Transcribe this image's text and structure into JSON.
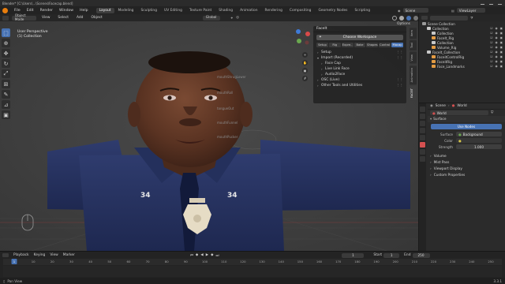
{
  "window": {
    "title": "Blender* [C:\\Users\\...\\Scenes\\Facecap.blend]"
  },
  "menubar": {
    "menus": [
      "File",
      "Edit",
      "Render",
      "Window",
      "Help"
    ],
    "workspaces": [
      "Layout",
      "Modeling",
      "Sculpting",
      "UV Editing",
      "Texture Paint",
      "Shading",
      "Animation",
      "Rendering",
      "Compositing",
      "Geometry Nodes",
      "Scripting"
    ],
    "active_workspace": "Layout",
    "scene_label": "Scene",
    "view_layer_label": "ViewLayer"
  },
  "viewport_header": {
    "mode": "Object Mode",
    "menus": [
      "View",
      "Select",
      "Add",
      "Object"
    ],
    "transform": "Global",
    "options": "Options"
  },
  "viewport_overlay": {
    "line1": "User Perspective",
    "line2": "(1) Collection"
  },
  "toolstrip": [
    "select-icon",
    "cursor-icon",
    "move-icon",
    "rotate-icon",
    "scale-icon",
    "transform-icon",
    "annotate-icon",
    "measure-icon",
    "add-cube-icon"
  ],
  "npanel": {
    "title": "FaceIt",
    "workspace_button": "Choose Workspace",
    "tabs": [
      "Setup",
      "Rig",
      "Expre..",
      "Bake",
      "Shapes",
      "Control",
      "Mocap"
    ],
    "active_tab": "Mocap",
    "sections": [
      {
        "label": "Setup",
        "open": false,
        "level": 0
      },
      {
        "label": "Import (Recorded)",
        "open": true,
        "level": 0
      },
      {
        "label": "Face Cap",
        "open": false,
        "level": 1
      },
      {
        "label": "Live Link Face",
        "open": false,
        "level": 1
      },
      {
        "label": "Audio2Face",
        "open": false,
        "level": 1
      },
      {
        "label": "OSC (Live)",
        "open": false,
        "level": 0
      },
      {
        "label": "Other Tools and Utilities",
        "open": false,
        "level": 0
      }
    ]
  },
  "sidetabs": [
    "Item",
    "Tool",
    "View",
    "Animation",
    "FACEIT"
  ],
  "sidetabs_active": "FACEIT",
  "outliner": {
    "rows": [
      {
        "label": "Scene Collection",
        "indent": 0,
        "color": "#9a9a9a",
        "selected": false
      },
      {
        "label": "Collection",
        "indent": 1,
        "color": "#c8c8c8",
        "selected": false
      },
      {
        "label": "Collection",
        "indent": 2,
        "color": "#c8c8c8",
        "selected": false
      },
      {
        "label": "FaceIt_Rig",
        "indent": 2,
        "color": "#e39b43",
        "selected": false
      },
      {
        "label": "Collection",
        "indent": 2,
        "color": "#c8c8c8",
        "selected": false
      },
      {
        "label": "Volume_Rig",
        "indent": 2,
        "color": "#e39b43",
        "selected": false
      },
      {
        "label": "FaceIt_Collection",
        "indent": 1,
        "color": "#c8c8c8",
        "selected": false
      },
      {
        "label": "FaceitControlRig",
        "indent": 2,
        "color": "#e39b43",
        "selected": false
      },
      {
        "label": "FaceitRig",
        "indent": 2,
        "color": "#e39b43",
        "selected": false
      },
      {
        "label": "Face_Landmarks",
        "indent": 2,
        "color": "#e39b43",
        "selected": false
      }
    ]
  },
  "properties": {
    "scene_label": "Scene",
    "world_label": "World",
    "world_name": "World",
    "surface_label": "Surface",
    "use_nodes": "Use Nodes",
    "surface_key": "Surface",
    "surface_val": "Background",
    "color_key": "Color",
    "strength_key": "Strength",
    "strength_val": "1.000",
    "sections": [
      "Volume",
      "Mist Pass",
      "Viewport Display",
      "Custom Properties"
    ]
  },
  "timeline": {
    "menus": [
      "Playback",
      "Keying",
      "View",
      "Marker"
    ],
    "current_frame": "1",
    "start_label": "Start",
    "start": "1",
    "end_label": "End",
    "end": "250",
    "ruler": [
      "1",
      "10",
      "20",
      "30",
      "40",
      "50",
      "60",
      "70",
      "80",
      "90",
      "100",
      "110",
      "120",
      "130",
      "140",
      "150",
      "160",
      "170",
      "180",
      "190",
      "200",
      "210",
      "220",
      "230",
      "240",
      "250"
    ]
  },
  "statusbar": {
    "left": "Pan View",
    "right": "3.3.1"
  }
}
